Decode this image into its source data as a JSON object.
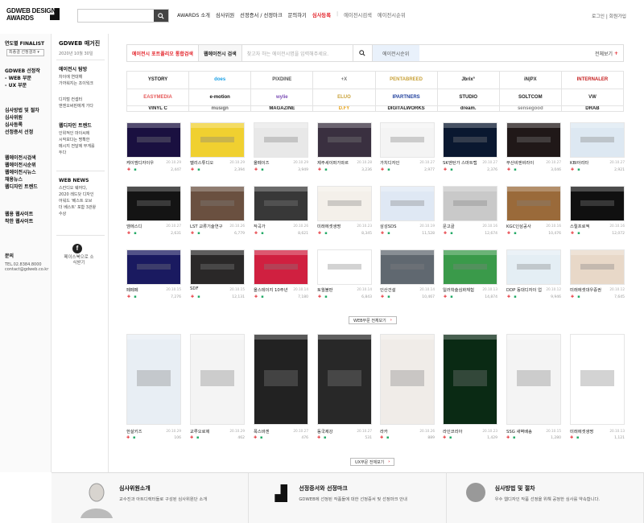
{
  "header": {
    "logo_line1": "GDWEB DESIGN",
    "logo_line2": "AWARDS",
    "search_placeholder": "",
    "nav": [
      {
        "label": "AWARDS 소개",
        "state": "normal"
      },
      {
        "label": "심사위원",
        "state": "normal"
      },
      {
        "label": "선정증서 / 선정마크",
        "state": "normal"
      },
      {
        "label": "문의하기",
        "state": "normal"
      },
      {
        "label": "심사등록",
        "state": "active"
      },
      {
        "label": "|",
        "state": "sep"
      },
      {
        "label": "에이전시검색",
        "state": "gray"
      },
      {
        "label": "에이전시순위",
        "state": "gray"
      }
    ],
    "toplinks": "로그인 | 회원가입"
  },
  "sidebar": {
    "finalist": "연도별 FINALIST",
    "select": "최종결 선정결과",
    "group1": [
      "GDWEB 선정작",
      "- WEB 부문",
      "- UX 부문"
    ],
    "group2": [
      "심사방법 및 절차",
      "심사위원",
      "심사등록",
      "선정증서 선정"
    ],
    "group3": [
      "웹에이전시검색",
      "웹에이전시순위",
      "웹에이전시뉴스",
      "채용뉴스",
      "웹디자인 트렌드"
    ],
    "group4": [
      "웹용 웹사이트",
      "착한 웹사이트"
    ],
    "contact_title": "문의",
    "contact_lines": [
      "TEL.02.8384.8000",
      "contact@gdweb.co.kr"
    ]
  },
  "magazine": {
    "title": "GDWEB 매거진",
    "date": "2020년 10월 30일",
    "blocks": [
      {
        "title": "에이전시 탐방",
        "lines": [
          "차이에 연대해",
          "가까워지는 조이웍크"
        ]
      },
      {
        "title": "",
        "lines": [
          "디지털 컨셉터",
          "앤엔오써핀에게 가다"
        ]
      },
      {
        "title": "웹디자인 트렌드",
        "lines": [
          "인위적인 마이씨에",
          "시작보다는 명확한",
          "메시지 전달에 무게를",
          "두다"
        ]
      },
      {
        "title": "WEB NEWS",
        "lines": [
          "스칸디오 웨어다,",
          "2020 레드닷 디자인",
          "어워드 '베스트 오브",
          "더 베스트' 포함 3관왕",
          "수상"
        ]
      }
    ],
    "fb_icon": "f",
    "fb_text": "페이스북으로 소식받기"
  },
  "tabs": {
    "t1": "에이전시 포트폴리오 통합검색",
    "t2": "웹에이전시 검색",
    "t3_placeholder": "찾고자 하는 에이전시명을 입력해주세요.",
    "t5": "에이전시순위",
    "t6": "전체보기",
    "t6_icon": "+"
  },
  "logos": [
    {
      "text": "YSTORY",
      "color": "#222"
    },
    {
      "text": "does",
      "color": "#1aa0e6"
    },
    {
      "text": "PIXDINE",
      "color": "#555"
    },
    {
      "text": "+X",
      "color": "#777"
    },
    {
      "text": "PENTABREED",
      "color": "#c9a23a"
    },
    {
      "text": "Jbrix°",
      "color": "#222"
    },
    {
      "text": "iN|PX",
      "color": "#333"
    },
    {
      "text": "INTERNALER",
      "color": "#c61f1f"
    },
    {
      "text": "EASYMEDIA",
      "color": "#e65a5a"
    },
    {
      "text": "e-motion",
      "color": "#111"
    },
    {
      "text": "wylie",
      "color": "#7b4db5"
    },
    {
      "text": "ELUO",
      "color": "#c9a23a"
    },
    {
      "text": "IPARTNERS",
      "color": "#1f3f9c"
    },
    {
      "text": "STUDIO",
      "color": "#222"
    },
    {
      "text": "SOLTCOM",
      "color": "#222"
    },
    {
      "text": "VW",
      "color": "#333"
    },
    {
      "text": "VINYL C",
      "color": "#222"
    },
    {
      "text": "musign",
      "color": "#666"
    },
    {
      "text": "MAGAZINE",
      "color": "#222"
    },
    {
      "text": "D.FY",
      "color": "#e6a21a"
    },
    {
      "text": "DIGITALWORKS",
      "color": "#222"
    },
    {
      "text": "dream.",
      "color": "#222"
    },
    {
      "text": "sensegood",
      "color": "#888"
    },
    {
      "text": "DRAB",
      "color": "#222"
    }
  ],
  "row1": [
    {
      "name": "케이엠디자이우",
      "date": "20.10.29",
      "count": "2,447",
      "bg": "#1a1040"
    },
    {
      "name": "멜리스튜디오",
      "date": "20.10.29",
      "count": "2,394",
      "bg": "#f0d030"
    },
    {
      "name": "올페이즈",
      "date": "20.10.29",
      "count": "3,949",
      "bg": "#e8e8e8"
    },
    {
      "name": "제주세이퍼가와르",
      "date": "20.10.28",
      "count": "3,236",
      "bg": "#3a3040"
    },
    {
      "name": "가치디자인",
      "date": "20.10.27",
      "count": "2,977",
      "bg": "#f4f4f4"
    },
    {
      "name": "SK엔턴가 스마트랩",
      "date": "20.10.27",
      "count": "2,376",
      "bg": "#0a1830"
    },
    {
      "name": "부산비엔비라이",
      "date": "20.10.27",
      "count": "3,046",
      "bg": "#201818"
    },
    {
      "name": "KBI아리타",
      "date": "20.10.27",
      "count": "2,921",
      "bg": "#dde8f2"
    }
  ],
  "row2": [
    {
      "name": "엠에스디",
      "date": "20.10.27",
      "count": "2,631",
      "bg": "#141414"
    },
    {
      "name": "LST 교류기술연구",
      "date": "20.10.26",
      "count": "6,779",
      "bg": "#6a5040"
    },
    {
      "name": "작곡가",
      "date": "20.10.26",
      "count": "8,621",
      "bg": "#383838"
    },
    {
      "name": "미래에셋생명",
      "date": "20.10.23",
      "count": "8,345",
      "bg": "#f4f0ea"
    },
    {
      "name": "삼성SDS",
      "date": "20.10.19",
      "count": "11,528",
      "bg": "#dfe8f4"
    },
    {
      "name": "문고골",
      "date": "20.10.16",
      "count": "12,674",
      "bg": "#c9c9c9"
    },
    {
      "name": "KGC인삼공사",
      "date": "20.10.16",
      "count": "10,476",
      "bg": "#9a6a3a"
    },
    {
      "name": "스릴프로젝",
      "date": "20.10.16",
      "count": "12,072",
      "bg": "#101010"
    }
  ],
  "row3": [
    {
      "name": "페페페",
      "date": "20.10.15",
      "count": "7,276",
      "bg": "#1a1a60"
    },
    {
      "name": "SDF",
      "date": "20.10.15",
      "count": "12,131",
      "bg": "#2a2828"
    },
    {
      "name": "올스테이지 10주년",
      "date": "20.10.14",
      "count": "7,180",
      "bg": "#d02040"
    },
    {
      "name": "토월불판",
      "date": "20.10.14",
      "count": "6,843",
      "bg": "#ffffff"
    },
    {
      "name": "인산건설",
      "date": "20.10.14",
      "count": "10,467",
      "bg": "#606870"
    },
    {
      "name": "일러학술심화체험",
      "date": "20.10.13",
      "count": "14,874",
      "bg": "#3a9a4a"
    },
    {
      "name": "DDP 동대디자이 업",
      "date": "20.10.12",
      "count": "9,946",
      "bg": "#e4eef4"
    },
    {
      "name": "미래에셋대우증권",
      "date": "20.10.12",
      "count": "7,645",
      "bg": "#e8d8c8"
    }
  ],
  "more1": "WEB부문 전체보기",
  "row4": [
    {
      "name": "한살키즈",
      "date": "20.10.29",
      "count": "106",
      "bg": "#e8eef4"
    },
    {
      "name": "교루오로제",
      "date": "20.10.29",
      "count": "462",
      "bg": "#f4f4f4"
    },
    {
      "name": "폭스바겐",
      "date": "20.10.27",
      "count": "476",
      "bg": "#222222"
    },
    {
      "name": "동국제강",
      "date": "20.10.27",
      "count": "531",
      "bg": "#282828"
    },
    {
      "name": "라카",
      "date": "20.10.26",
      "count": "889",
      "bg": "#f0ece8"
    },
    {
      "name": "라인코리아",
      "date": "20.10.23",
      "count": "1,429",
      "bg": "#0a2a14"
    },
    {
      "name": "SSG 새벽배송",
      "date": "20.10.15",
      "count": "1,280",
      "bg": "#f4f4f4"
    },
    {
      "name": "미래에셋생명",
      "date": "20.10.13",
      "count": "1,121",
      "bg": "#ffffff"
    }
  ],
  "more2": "UX부문 전체보기",
  "footer": [
    {
      "title": "심사위원소개",
      "desc": "교수진과 아트디렉터들로 구성된 심사위원단 소개"
    },
    {
      "title": "선정증서와 선정마크",
      "desc": "GDWEB에 선정된 작품들에 대한 선정증서 및 선정마크 안내"
    },
    {
      "title": "심사방법 및 절차",
      "desc": "우수 웹디자인 작품 선정을 위해 공정한 심사를 약속합니다."
    }
  ]
}
